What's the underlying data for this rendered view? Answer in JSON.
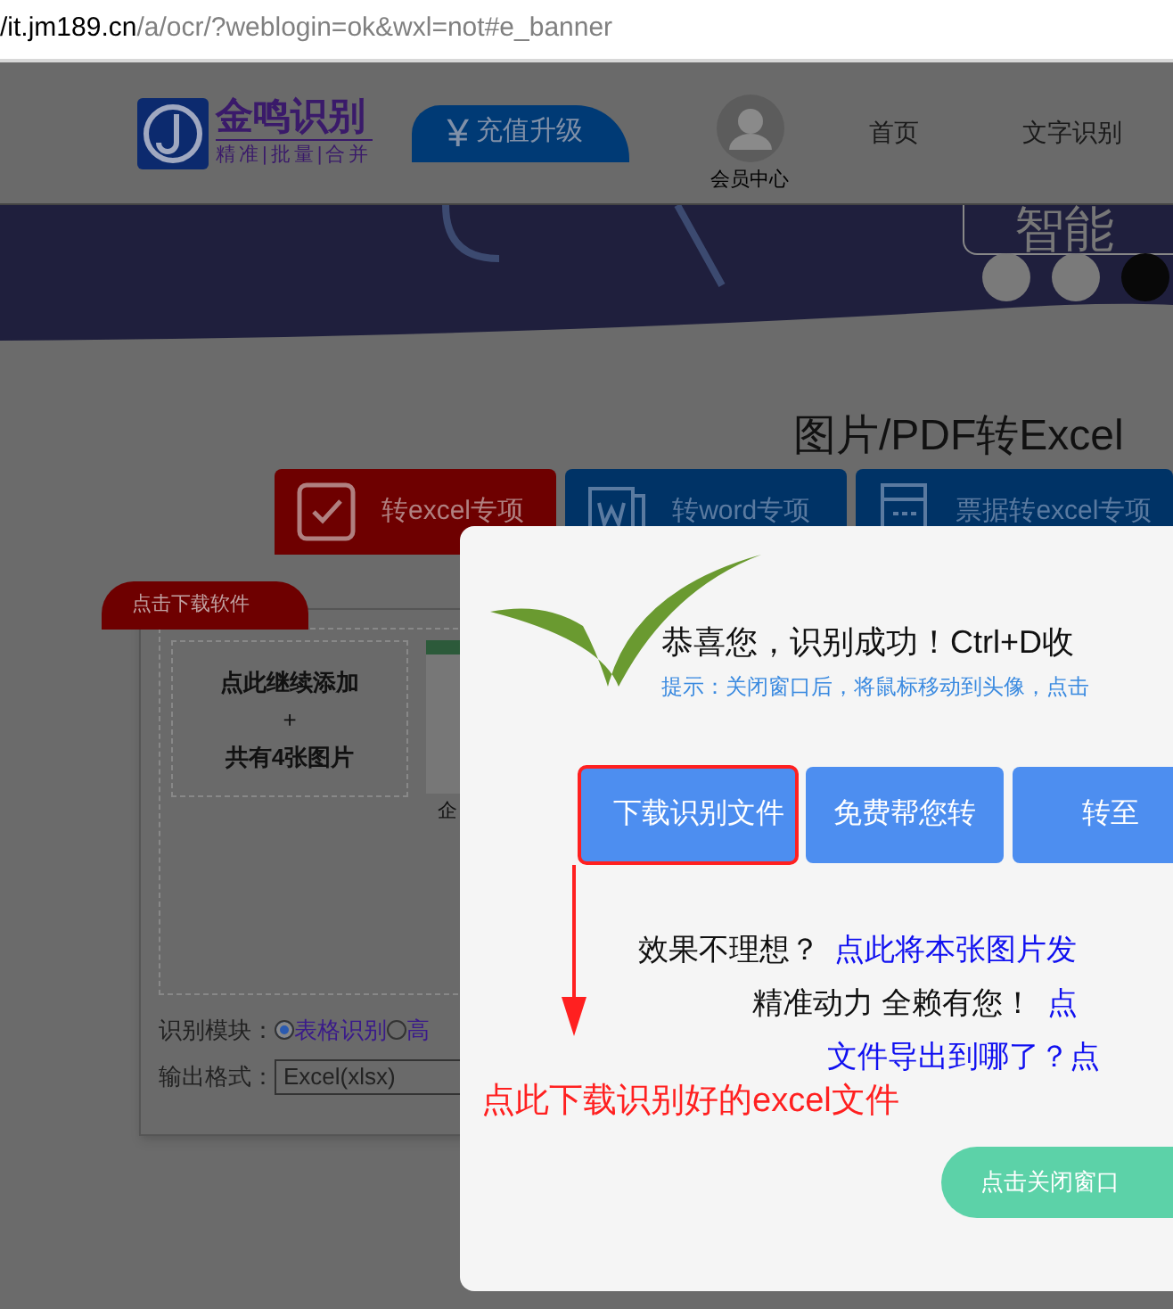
{
  "address_bar": {
    "host": "/it.jm189.cn",
    "path": "/a/ocr/?weblogin=ok&wxl=not#e_banner"
  },
  "header": {
    "logo": {
      "name": "金鸣识别",
      "slogan": "精准|批量|合并"
    },
    "currency_icon": "¥",
    "recharge_button": "充值升级",
    "member": "会员中心",
    "nav": [
      {
        "label": "首页"
      },
      {
        "label": "文字识别"
      }
    ]
  },
  "banner": {
    "text": "智能",
    "dots": [
      {
        "selected": false
      },
      {
        "selected": false
      },
      {
        "selected": true
      }
    ]
  },
  "title": "图片/PDF转Excel",
  "tabs": [
    {
      "label": "转excel专项",
      "selected": true,
      "kind": "check"
    },
    {
      "label": "转word专项",
      "selected": false,
      "kind": "word"
    },
    {
      "label": "票据转excel专项",
      "selected": false,
      "kind": "ticket"
    }
  ],
  "download_tab": "点击下载软件",
  "upload": {
    "add_text": "点此继续添加",
    "plus": "+",
    "count": "共有4张图片",
    "thumbnail_caption": "企"
  },
  "options": {
    "module_label": "识别模块：",
    "modules": [
      {
        "label": "表格识别",
        "selected": true
      },
      {
        "label": "高",
        "selected": false
      }
    ],
    "format_label": "输出格式：",
    "format": "Excel(xlsx)"
  },
  "dialog": {
    "message": "恭喜您，识别成功！Ctrl+D收",
    "hint": "提示：关闭窗口后，将鼠标移动到头像，点击",
    "buttons": [
      {
        "label": "下载识别文件",
        "highlighted": true
      },
      {
        "label": "免费帮您转",
        "highlighted": false
      },
      {
        "label": "转至",
        "highlighted": false
      }
    ],
    "lines": [
      [
        {
          "text": "效果不理想？",
          "kind": "plain"
        },
        {
          "text": "点此将本张图片发",
          "kind": "link"
        }
      ],
      [
        {
          "text": "精准动力 全赖有您！",
          "kind": "plain"
        },
        {
          "text": "点",
          "kind": "link"
        }
      ],
      [
        {
          "text": "文件导出到哪了？点",
          "kind": "link"
        }
      ]
    ],
    "annotation": "点此下载识别好的excel文件",
    "close_button": "点击关闭窗口"
  }
}
